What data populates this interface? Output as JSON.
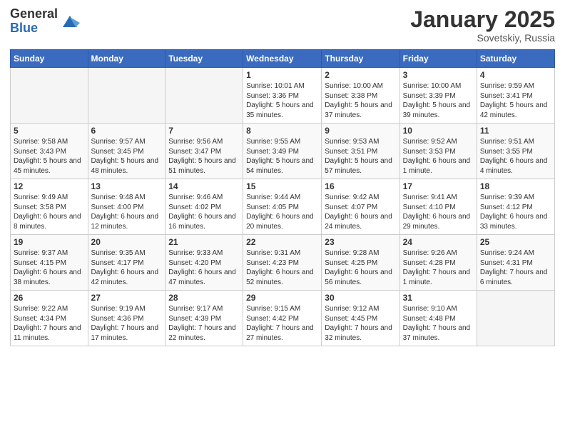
{
  "logo": {
    "general": "General",
    "blue": "Blue"
  },
  "title": "January 2025",
  "subtitle": "Sovetskiy, Russia",
  "days": [
    "Sunday",
    "Monday",
    "Tuesday",
    "Wednesday",
    "Thursday",
    "Friday",
    "Saturday"
  ],
  "weeks": [
    [
      {
        "num": "",
        "text": ""
      },
      {
        "num": "",
        "text": ""
      },
      {
        "num": "",
        "text": ""
      },
      {
        "num": "1",
        "text": "Sunrise: 10:01 AM\nSunset: 3:36 PM\nDaylight: 5 hours and 35 minutes."
      },
      {
        "num": "2",
        "text": "Sunrise: 10:00 AM\nSunset: 3:38 PM\nDaylight: 5 hours and 37 minutes."
      },
      {
        "num": "3",
        "text": "Sunrise: 10:00 AM\nSunset: 3:39 PM\nDaylight: 5 hours and 39 minutes."
      },
      {
        "num": "4",
        "text": "Sunrise: 9:59 AM\nSunset: 3:41 PM\nDaylight: 5 hours and 42 minutes."
      }
    ],
    [
      {
        "num": "5",
        "text": "Sunrise: 9:58 AM\nSunset: 3:43 PM\nDaylight: 5 hours and 45 minutes."
      },
      {
        "num": "6",
        "text": "Sunrise: 9:57 AM\nSunset: 3:45 PM\nDaylight: 5 hours and 48 minutes."
      },
      {
        "num": "7",
        "text": "Sunrise: 9:56 AM\nSunset: 3:47 PM\nDaylight: 5 hours and 51 minutes."
      },
      {
        "num": "8",
        "text": "Sunrise: 9:55 AM\nSunset: 3:49 PM\nDaylight: 5 hours and 54 minutes."
      },
      {
        "num": "9",
        "text": "Sunrise: 9:53 AM\nSunset: 3:51 PM\nDaylight: 5 hours and 57 minutes."
      },
      {
        "num": "10",
        "text": "Sunrise: 9:52 AM\nSunset: 3:53 PM\nDaylight: 6 hours and 1 minute."
      },
      {
        "num": "11",
        "text": "Sunrise: 9:51 AM\nSunset: 3:55 PM\nDaylight: 6 hours and 4 minutes."
      }
    ],
    [
      {
        "num": "12",
        "text": "Sunrise: 9:49 AM\nSunset: 3:58 PM\nDaylight: 6 hours and 8 minutes."
      },
      {
        "num": "13",
        "text": "Sunrise: 9:48 AM\nSunset: 4:00 PM\nDaylight: 6 hours and 12 minutes."
      },
      {
        "num": "14",
        "text": "Sunrise: 9:46 AM\nSunset: 4:02 PM\nDaylight: 6 hours and 16 minutes."
      },
      {
        "num": "15",
        "text": "Sunrise: 9:44 AM\nSunset: 4:05 PM\nDaylight: 6 hours and 20 minutes."
      },
      {
        "num": "16",
        "text": "Sunrise: 9:42 AM\nSunset: 4:07 PM\nDaylight: 6 hours and 24 minutes."
      },
      {
        "num": "17",
        "text": "Sunrise: 9:41 AM\nSunset: 4:10 PM\nDaylight: 6 hours and 29 minutes."
      },
      {
        "num": "18",
        "text": "Sunrise: 9:39 AM\nSunset: 4:12 PM\nDaylight: 6 hours and 33 minutes."
      }
    ],
    [
      {
        "num": "19",
        "text": "Sunrise: 9:37 AM\nSunset: 4:15 PM\nDaylight: 6 hours and 38 minutes."
      },
      {
        "num": "20",
        "text": "Sunrise: 9:35 AM\nSunset: 4:17 PM\nDaylight: 6 hours and 42 minutes."
      },
      {
        "num": "21",
        "text": "Sunrise: 9:33 AM\nSunset: 4:20 PM\nDaylight: 6 hours and 47 minutes."
      },
      {
        "num": "22",
        "text": "Sunrise: 9:31 AM\nSunset: 4:23 PM\nDaylight: 6 hours and 52 minutes."
      },
      {
        "num": "23",
        "text": "Sunrise: 9:28 AM\nSunset: 4:25 PM\nDaylight: 6 hours and 56 minutes."
      },
      {
        "num": "24",
        "text": "Sunrise: 9:26 AM\nSunset: 4:28 PM\nDaylight: 7 hours and 1 minute."
      },
      {
        "num": "25",
        "text": "Sunrise: 9:24 AM\nSunset: 4:31 PM\nDaylight: 7 hours and 6 minutes."
      }
    ],
    [
      {
        "num": "26",
        "text": "Sunrise: 9:22 AM\nSunset: 4:34 PM\nDaylight: 7 hours and 11 minutes."
      },
      {
        "num": "27",
        "text": "Sunrise: 9:19 AM\nSunset: 4:36 PM\nDaylight: 7 hours and 17 minutes."
      },
      {
        "num": "28",
        "text": "Sunrise: 9:17 AM\nSunset: 4:39 PM\nDaylight: 7 hours and 22 minutes."
      },
      {
        "num": "29",
        "text": "Sunrise: 9:15 AM\nSunset: 4:42 PM\nDaylight: 7 hours and 27 minutes."
      },
      {
        "num": "30",
        "text": "Sunrise: 9:12 AM\nSunset: 4:45 PM\nDaylight: 7 hours and 32 minutes."
      },
      {
        "num": "31",
        "text": "Sunrise: 9:10 AM\nSunset: 4:48 PM\nDaylight: 7 hours and 37 minutes."
      },
      {
        "num": "",
        "text": ""
      }
    ]
  ]
}
